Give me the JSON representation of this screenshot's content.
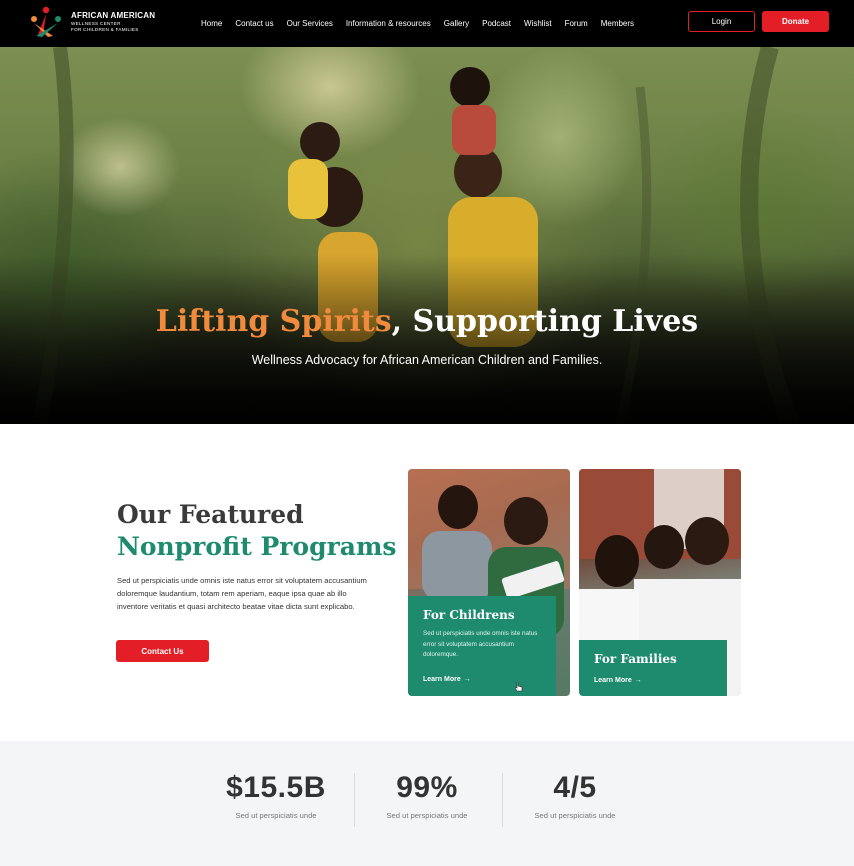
{
  "brand": {
    "line1": "AFRICAN AMERICAN",
    "line2": "WELLNESS CENTER",
    "line3": "FOR CHILDREN & FAMILIES",
    "logo_icon": "three-figures-logo-icon"
  },
  "nav": {
    "items": [
      "Home",
      "Contact us",
      "Our Services",
      "Information & resources",
      "Gallery",
      "Podcast",
      "Wishlist",
      "Forum",
      "Members"
    ],
    "login": "Login",
    "donate": "Donate"
  },
  "hero": {
    "title_accent": "Lifting Spirits",
    "title_rest": ", Supporting Lives",
    "subtitle": "Wellness Advocacy for African American Children and Families."
  },
  "featured": {
    "title_line1": "Our Featured",
    "title_line2": "Nonprofit Programs",
    "description": "Sed ut perspiciatis unde omnis iste natus error sit voluptatem accusantium doloremque laudantium, totam rem aperiam, eaque ipsa quae ab illo inventore veritatis et quasi architecto beatae vitae dicta sunt explicabo.",
    "contact_button": "Contact Us",
    "cards": [
      {
        "title": "For Childrens",
        "text": "Sed ut perspiciatis unde omnis iste natus error sit voluptatem accusantium doloremque.",
        "link": "Learn More"
      },
      {
        "title": "For Families",
        "link": "Learn More"
      }
    ]
  },
  "stats": [
    {
      "value": "$15.5B",
      "label": "Sed ut perspiciatis unde"
    },
    {
      "value": "99%",
      "label": "Sed ut perspiciatis unde"
    },
    {
      "value": "4/5",
      "label": "Sed ut perspiciatis unde"
    }
  ],
  "colors": {
    "accent_red": "#e41e26",
    "brand_green": "#1e8b6f",
    "hero_orange": "#f08a3c"
  }
}
